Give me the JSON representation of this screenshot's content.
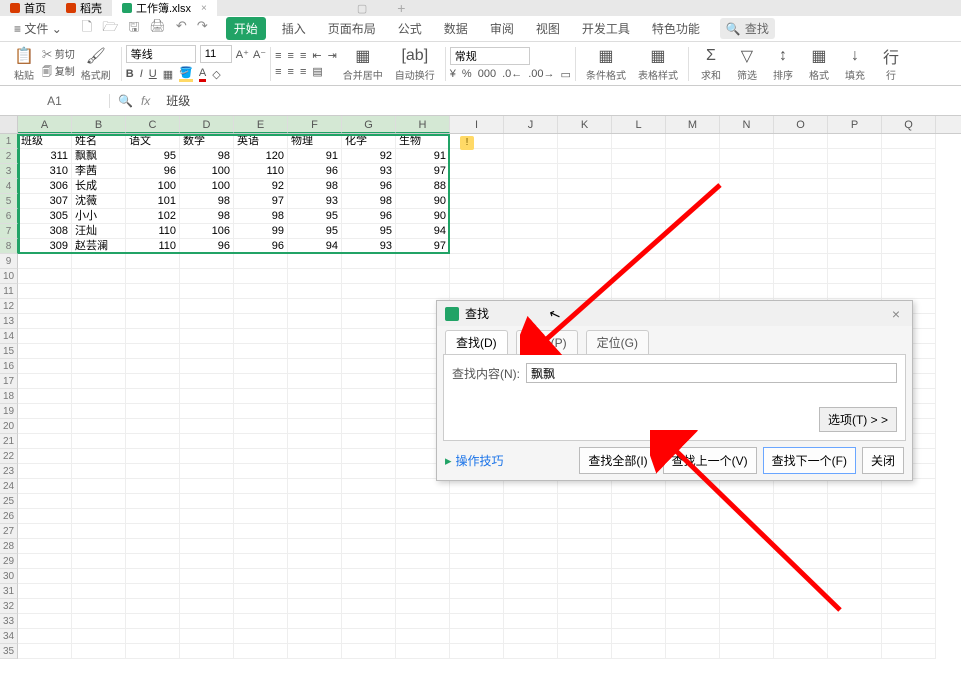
{
  "tabs": {
    "items": [
      {
        "icon_color": "#d83b01",
        "label": "首页"
      },
      {
        "icon_color": "#d83b01",
        "label": "稻壳"
      },
      {
        "icon_color": "#21a366",
        "label": "工作簿.xlsx"
      }
    ]
  },
  "menu": {
    "file": "文件",
    "items": [
      "开始",
      "插入",
      "页面布局",
      "公式",
      "数据",
      "审阅",
      "视图",
      "开发工具",
      "特色功能"
    ],
    "search": "查找"
  },
  "ribbon": {
    "paste": "粘贴",
    "cut": "剪切",
    "copy": "复制",
    "format_painter": "格式刷",
    "font_name": "等线",
    "font_size": "11",
    "number_format": "常规",
    "merge_center": "合并居中",
    "auto_wrap": "自动换行",
    "cond_format": "条件格式",
    "table_style": "表格样式",
    "sum": "求和",
    "filter": "筛选",
    "sort": "排序",
    "format": "格式",
    "fill": "填充",
    "row": "行"
  },
  "formula_bar": {
    "name_box": "A1",
    "fx": "fx",
    "value": "班级"
  },
  "columns": [
    "A",
    "B",
    "C",
    "D",
    "E",
    "F",
    "G",
    "H",
    "I",
    "J",
    "K",
    "L",
    "M",
    "N",
    "O",
    "P",
    "Q"
  ],
  "rows_header": [
    "1",
    "2",
    "3",
    "4",
    "5",
    "6",
    "7",
    "8",
    "9",
    "10",
    "11",
    "12",
    "13",
    "14",
    "15",
    "16",
    "17",
    "18",
    "19",
    "20",
    "21",
    "22",
    "23",
    "24",
    "25",
    "26",
    "27",
    "28",
    "29",
    "30",
    "31",
    "32",
    "33",
    "34",
    "35"
  ],
  "table": {
    "headers": [
      "班级",
      "姓名",
      "语文",
      "数学",
      "英语",
      "物理",
      "化学",
      "生物"
    ],
    "rows": [
      [
        "311",
        "飘飘",
        "95",
        "98",
        "120",
        "91",
        "92",
        "91"
      ],
      [
        "310",
        "李茜",
        "96",
        "100",
        "110",
        "96",
        "93",
        "97"
      ],
      [
        "306",
        "长成",
        "100",
        "100",
        "92",
        "98",
        "96",
        "88"
      ],
      [
        "307",
        "沈薇",
        "101",
        "98",
        "97",
        "93",
        "98",
        "90"
      ],
      [
        "305",
        "小小",
        "102",
        "98",
        "98",
        "95",
        "96",
        "90"
      ],
      [
        "308",
        "汪灿",
        "110",
        "106",
        "99",
        "95",
        "95",
        "94"
      ],
      [
        "309",
        "赵芸澜",
        "110",
        "96",
        "96",
        "94",
        "93",
        "97"
      ]
    ]
  },
  "find_dialog": {
    "title": "查找",
    "tabs": [
      "查找(D)",
      "替换(P)",
      "定位(G)"
    ],
    "label_find": "查找内容(N):",
    "value": "飘飘",
    "options_btn": "选项(T) > >",
    "tips": "操作技巧",
    "btn_find_all": "查找全部(I)",
    "btn_find_prev": "查找上一个(V)",
    "btn_find_next": "查找下一个(F)",
    "btn_close": "关闭"
  },
  "chart_data": {
    "type": "table",
    "headers": [
      "班级",
      "姓名",
      "语文",
      "数学",
      "英语",
      "物理",
      "化学",
      "生物"
    ],
    "rows": [
      [
        311,
        "飘飘",
        95,
        98,
        120,
        91,
        92,
        91
      ],
      [
        310,
        "李茜",
        96,
        100,
        110,
        96,
        93,
        97
      ],
      [
        306,
        "长成",
        100,
        100,
        92,
        98,
        96,
        88
      ],
      [
        307,
        "沈薇",
        101,
        98,
        97,
        93,
        98,
        90
      ],
      [
        305,
        "小小",
        102,
        98,
        98,
        95,
        96,
        90
      ],
      [
        308,
        "汪灿",
        110,
        106,
        99,
        95,
        95,
        94
      ],
      [
        309,
        "赵芸澜",
        110,
        96,
        96,
        94,
        93,
        97
      ]
    ]
  }
}
